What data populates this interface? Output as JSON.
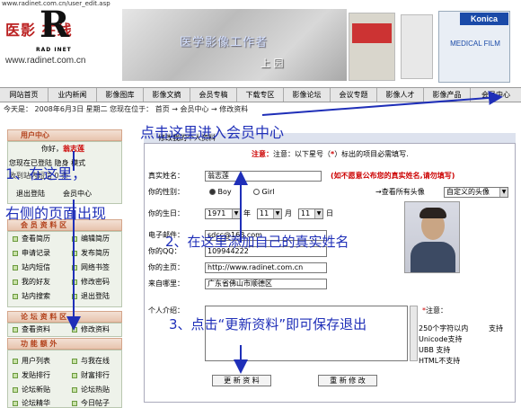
{
  "url": "www.radinet.com.cn/user_edit.asp",
  "banner": {
    "logo_text": "医影 在线",
    "logo_letter": "R",
    "logo_sub": "RAD INET",
    "logo_url": "www.radinet.com.cn",
    "photo_title": "医学影像工作者",
    "photo_sub": "上 园",
    "brand": "Konica",
    "brand_sub": "MEDICAL FILM"
  },
  "nav": {
    "items": [
      "网站首页",
      "业内新闻",
      "影像图库",
      "影像文摘",
      "会员专稿",
      "下载专区",
      "影像论坛",
      "会议专题",
      "影像人才",
      "影像产品",
      "会员中心"
    ]
  },
  "datebar": {
    "text": "今天是： 2008年6月3日 星期二   您现在位于： 首页 → 会员中心 → 修改资料"
  },
  "sidebar": {
    "member_center": "用户中心",
    "greeting": "你好，",
    "username": "翁志莲",
    "status_line": "您现在已登陆 隐身 模式",
    "status_line2": "收到站内短信 0 条",
    "logout": "退出登陆",
    "member_center_link": "会员中心",
    "sec_member": "会 员 资 料 区",
    "member_links": [
      "查看简历",
      "编辑简历",
      "申请记录",
      "发布简历",
      "站内短信",
      "网络书签",
      "我的好友",
      "修改密码",
      "站内搜索",
      "退出登陆"
    ],
    "sec_forum": "论 坛 资 料 区",
    "forum_links": [
      "查看资料",
      "修改资料"
    ],
    "sec_func": "功 能 额 外",
    "func_links": [
      "用户列表",
      "与我在线",
      "发贴排行",
      "财富排行",
      "论坛新贴",
      "论坛热贴",
      "论坛精华",
      "今日帖子"
    ]
  },
  "form": {
    "title": "修改我的个人资料",
    "notice_prefix": "注意：以下星号（",
    "notice_star": "*",
    "notice_suffix": "）标出的项目必需填写.",
    "real_name_label": "真实姓名：",
    "real_name_value": "翁志莲",
    "real_name_hint": "(如不愿意公布您的真实姓名,请勿填写)",
    "gender_label": "你的性别：",
    "gender_boy": "Boy",
    "gender_girl": "Girl",
    "avatar_link": "→查看所有头像",
    "avatar_select": "自定义的头像",
    "birthday_label": "你的生日：",
    "birthday_year": "1971",
    "year_unit": "年",
    "birthday_month": "11",
    "month_unit": "月",
    "birthday_day": "11",
    "day_unit": "日",
    "email_label": "电子邮件：",
    "email_value": "sdcc@163.com",
    "qq_label": "你的QQ：",
    "qq_value": "109944222",
    "homepage_label": "你的主页：",
    "homepage_value": "http://www.radinet.com.cn",
    "from_label": "来自哪里：",
    "from_value": "广东省佛山市顺德区",
    "intro_label": "个人介绍：",
    "note_title": "注意：",
    "note_lines": [
      "250个字符以内",
      "支持",
      "Unicode支持",
      "UBB 支持",
      "HTML不支持"
    ],
    "update_button": "更 新 资 料",
    "reset_button": "重 新 修 改"
  },
  "annotations": {
    "top": "点击这里进入会员中心",
    "step1_a": "1、在这里，",
    "step1_b": "右侧的页面出现",
    "step2": "2、在这里添加自己的真实姓名",
    "step3": "3、点击“更新资料”即可保存退出"
  },
  "colors": {
    "annotation": "#1f2fb8",
    "accent_red": "#cc0000",
    "nav_bg": "#e6e6e6"
  }
}
